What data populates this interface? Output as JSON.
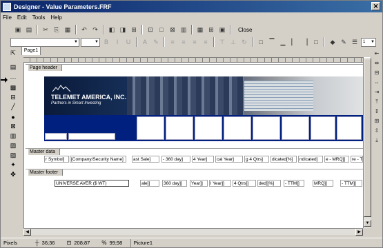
{
  "window": {
    "title": "Designer - Value Parameters.FRF",
    "close": "✕"
  },
  "menu": [
    "File",
    "Edit",
    "Tools",
    "Help"
  ],
  "toolbar": {
    "close_label": "Close",
    "font_size": "1"
  },
  "tab": {
    "label": "Page1"
  },
  "bands": {
    "page_header": "Page header",
    "master_data": "Master data",
    "master_footer": "Master footer"
  },
  "banner": {
    "company": "TELEMET AMERICA, INC.",
    "tagline": "Partners in Smart Investing"
  },
  "data_fields": [
    "r Symbol]",
    "[Company/Security Name]",
    "ast Sale]",
    "- 360 day]",
    "4 Year]",
    "cal Year]",
    "g 4 Qtrs]",
    "dicated[%]",
    "ndicated]",
    "e - MRQ]]",
    "re - TTM]]"
  ],
  "footer_fields": [
    "UNIVERSE AVER ($ WT)",
    "ale]]",
    "360 day]]",
    "Year]]",
    "l Year]]",
    "4 Qtrs]]",
    "ded]]%]",
    "- TTM]]",
    "MRQ]]",
    "- TTM]]"
  ],
  "status": {
    "units": "Pixels",
    "pos": "36;36",
    "size": "208;87",
    "zoom": "99;98",
    "object": "Picture1"
  }
}
